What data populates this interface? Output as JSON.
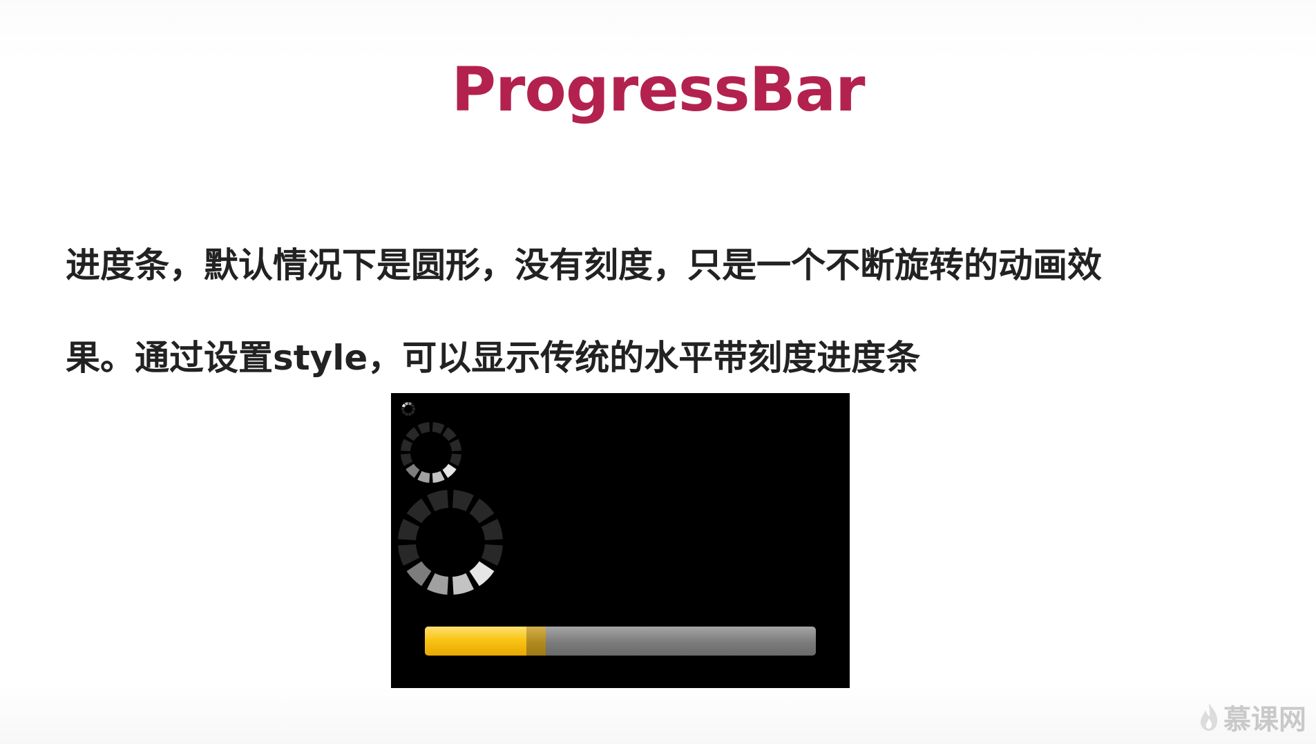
{
  "slide": {
    "title": "ProgressBar",
    "body_lines": [
      "进度条，默认情况下是圆形，没有刻度，只是一个不断旋转的动画效",
      "果。通过设置style，可以显示传统的水平带刻度进度条"
    ]
  },
  "demo": {
    "horizontal_bar": {
      "progress": 0.26,
      "secondary_progress": 0.31
    }
  },
  "watermark": {
    "text": "慕课网",
    "icon": "flame-icon"
  },
  "colors": {
    "title": "#b3224f",
    "progress_fill": "#f9c516",
    "track": "#7b7b7b"
  }
}
